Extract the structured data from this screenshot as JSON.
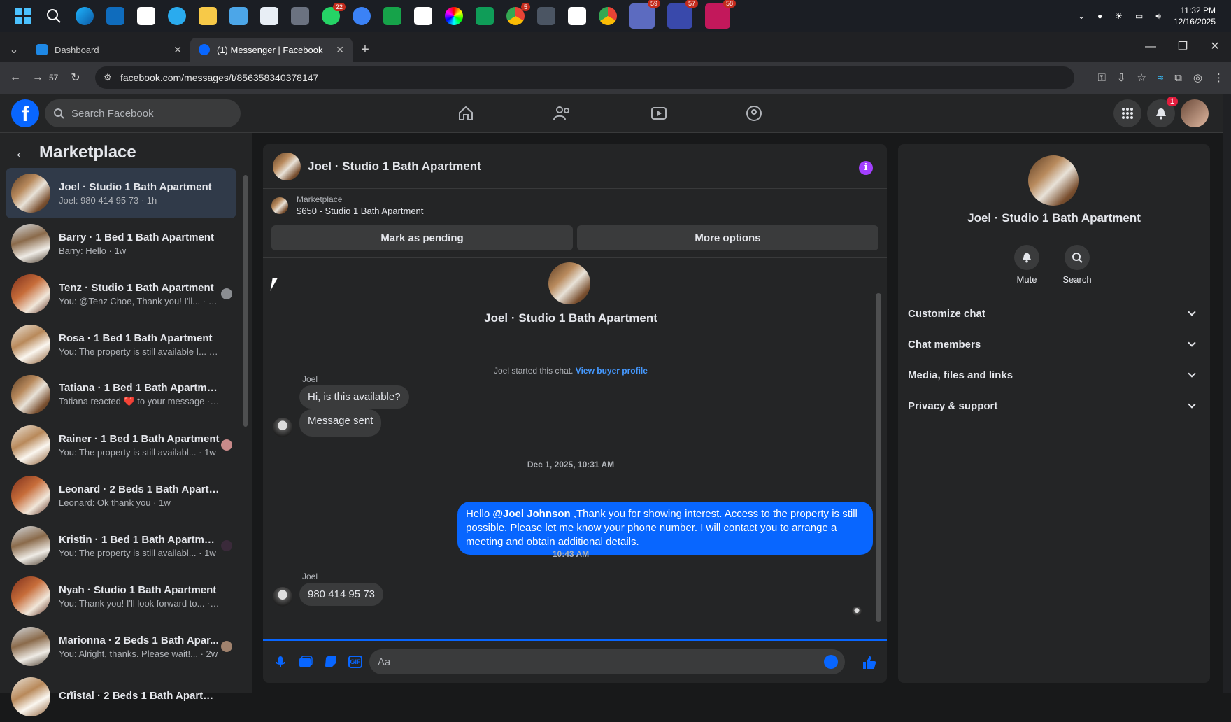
{
  "taskbar": {
    "icons": [
      "windows-start-icon",
      "search-icon",
      "edge-icon",
      "outlook-icon",
      "store-icon",
      "telegram-icon",
      "file-explorer-icon",
      "notepad-icon",
      "snipping-icon",
      "app-icon",
      "whatsapp-icon",
      "app-icon-2",
      "lock-app-icon",
      "azure-icon",
      "color-app-icon",
      "infinity-icon",
      "chrome-icon",
      "calculator-icon",
      "azure-icon-2",
      "chrome-icon-2",
      "browser-profile-icon-1",
      "browser-profile-icon-2",
      "browser-profile-icon-3"
    ],
    "whatsapp_badge": "22",
    "chrome_badge": "5",
    "profile_badges": [
      "59",
      "57",
      "58"
    ],
    "time": "11:32 PM",
    "date": "12/16/2025"
  },
  "browser": {
    "tabs": [
      {
        "label": "Dashboard"
      },
      {
        "label": "(1) Messenger | Facebook"
      }
    ],
    "history_count": "57",
    "url": "facebook.com/messages/t/856358340378147"
  },
  "fb": {
    "search_placeholder": "Search Facebook",
    "notification_count": "1"
  },
  "sidebar": {
    "title": "Marketplace",
    "chats": [
      {
        "name": "Joel · Studio 1 Bath Apartment",
        "preview": "Joel: 980 414 95 73 · 1h",
        "active": true
      },
      {
        "name": "Barry · 1 Bed 1 Bath Apartment",
        "preview": "Barry: Hello · 1w"
      },
      {
        "name": "Tenz · Studio 1 Bath Apartment",
        "preview": "You: @Tenz Choe, Thank you! I'll... · 1w"
      },
      {
        "name": "Rosa · 1 Bed 1 Bath Apartment",
        "preview": "You: The property is still available I... · 1w"
      },
      {
        "name": "Tatiana · 1 Bed 1 Bath Apartment",
        "preview": "Tatiana reacted ❤️ to your message · 1w"
      },
      {
        "name": "Rainer · 1 Bed 1 Bath Apartment",
        "preview": "You: The property is still availabl... · 1w"
      },
      {
        "name": "Leonard · 2 Beds 1 Bath Apartm...",
        "preview": "Leonard: Ok thank you · 1w"
      },
      {
        "name": "Kristin · 1 Bed 1 Bath Apartment",
        "preview": "You: The property is still availabl... · 1w"
      },
      {
        "name": "Nyah · Studio 1 Bath Apartment",
        "preview": "You: Thank you! I'll look forward to... · 2w"
      },
      {
        "name": "Marionna · 2 Beds 1 Bath Apar...",
        "preview": "You: Alright, thanks. Please wait!... · 2w"
      },
      {
        "name": "Crĩistal · 2 Beds 1 Bath Apartment",
        "preview": ""
      }
    ]
  },
  "conversation": {
    "title": "Joel · Studio 1 Bath Apartment",
    "marketplace_label": "Marketplace",
    "listing": "$650 - Studio 1 Bath Apartment",
    "mark_pending": "Mark as pending",
    "more_options": "More options",
    "intro_name": "Joel · Studio 1 Bath Apartment",
    "system_text": "Joel started this chat.",
    "system_link": "View buyer profile",
    "sender1": "Joel",
    "msg1": "Hi, is this available?",
    "msg2": "Message sent",
    "timestamp1": "Dec 1, 2025, 10:31 AM",
    "out_mention": "@Joel Johnson",
    "out_text": " ,Thank you for showing interest. Access to the property is still possible. Please let me know your phone number. I will contact you to arrange a meeting and obtain additional details.",
    "out_prefix": "Hello ",
    "timestamp2": "10:43 AM",
    "sender2": "Joel",
    "msg3": "980 414 95 73",
    "composer_placeholder": "Aa"
  },
  "info_panel": {
    "name": "Joel · Studio 1 Bath Apartment",
    "mute_label": "Mute",
    "search_label": "Search",
    "sections": [
      "Customize chat",
      "Chat members",
      "Media, files and links",
      "Privacy & support"
    ]
  },
  "colors": {
    "accent": "#0866ff",
    "info_purple": "#a33fff",
    "background": "#18191a",
    "surface": "#242526"
  }
}
